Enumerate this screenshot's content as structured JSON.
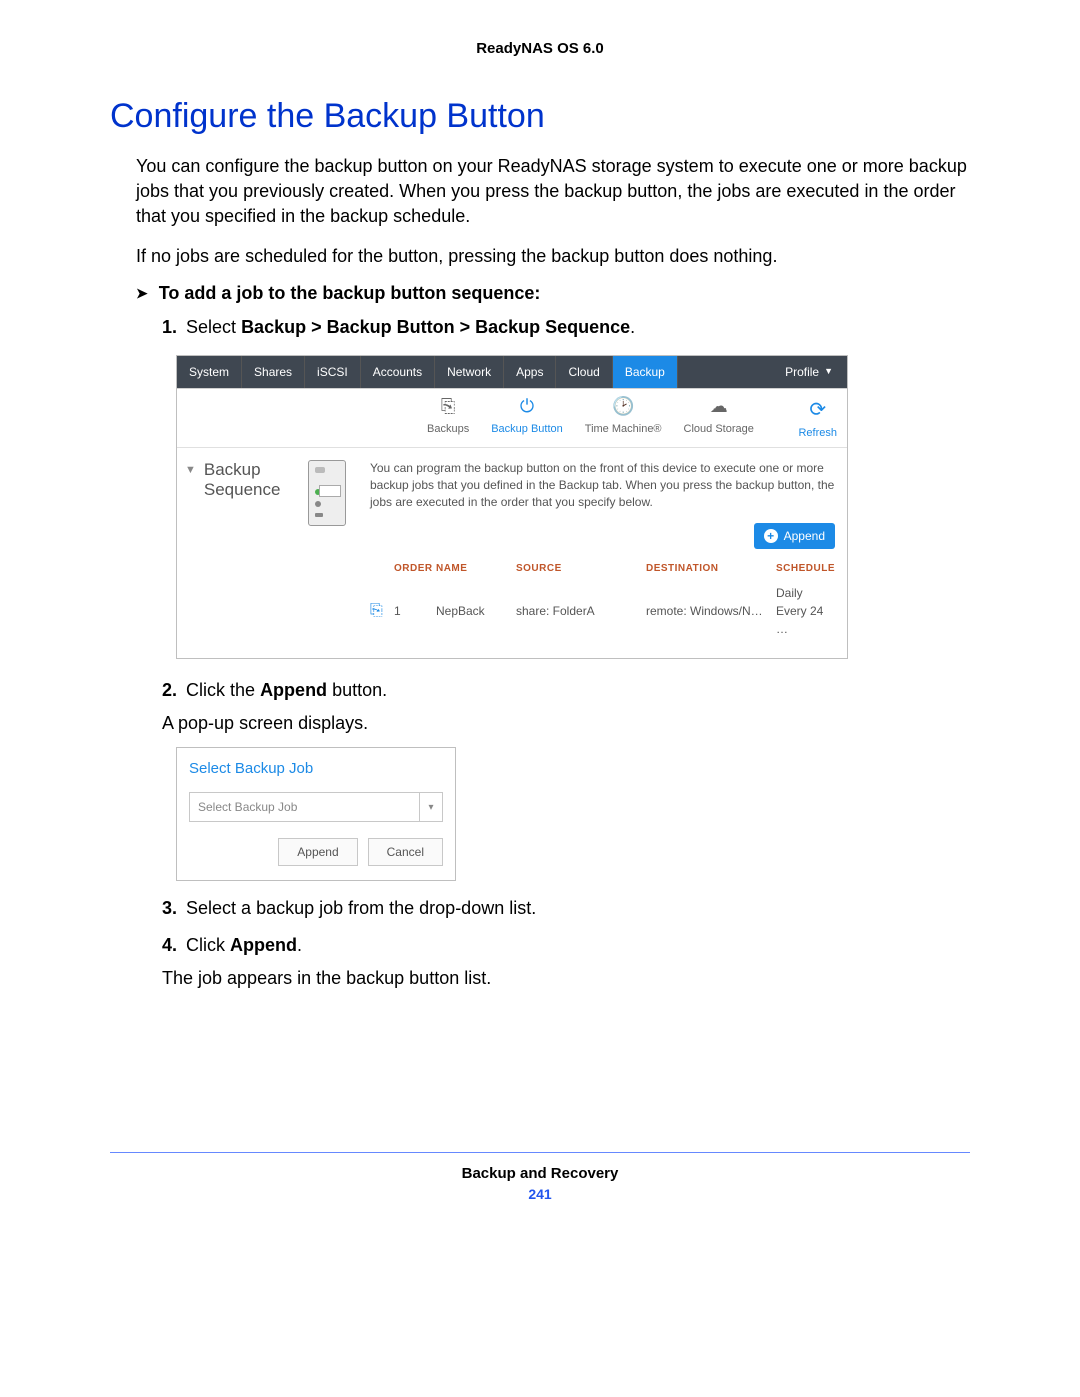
{
  "header": {
    "product": "ReadyNAS OS 6.0"
  },
  "title": "Configure the Backup Button",
  "intro1": "You can configure the backup button on your ReadyNAS storage system to execute one or more backup jobs that you previously created. When you press the backup button, the jobs are executed in the order that you specified in the backup schedule.",
  "intro2": "If no jobs are scheduled for the button, pressing the backup button does nothing.",
  "proc_heading": "To add a job to the backup button sequence:",
  "steps": {
    "s1a": "Select ",
    "s1b": "Backup > Backup Button > Backup Sequence",
    "s1c": ".",
    "s2a": "Click the ",
    "s2b": "Append",
    "s2c": " button.",
    "s2sub": "A pop-up screen displays.",
    "s3": "Select a backup job from the drop-down list.",
    "s4a": "Click ",
    "s4b": "Append",
    "s4c": ".",
    "s4sub": "The job appears in the backup button list."
  },
  "ui": {
    "tabs": {
      "system": "System",
      "shares": "Shares",
      "iscsi": "iSCSI",
      "accounts": "Accounts",
      "network": "Network",
      "apps": "Apps",
      "cloud": "Cloud",
      "backup": "Backup",
      "profile": "Profile"
    },
    "subtabs": {
      "backups": "Backups",
      "backup_button": "Backup Button",
      "time_machine": "Time Machine®",
      "cloud_storage": "Cloud Storage",
      "refresh": "Refresh"
    },
    "section_label_l1": "Backup",
    "section_label_l2": "Sequence",
    "desc": "You can program the backup button on the front of this device to execute one or more backup jobs that you defined in the Backup tab. When you press the backup button, the jobs are executed in the order that you specify below.",
    "append_btn": "Append",
    "cols": {
      "order": "ORDER",
      "name": "NAME",
      "source": "SOURCE",
      "destination": "DESTINATION",
      "schedule": "SCHEDULE"
    },
    "row": {
      "order": "1",
      "name": "NepBack",
      "source": "share: FolderA",
      "destination": "remote: Windows/N…",
      "schedule": "Daily Every 24 …"
    }
  },
  "dialog": {
    "title": "Select Backup Job",
    "placeholder": "Select Backup Job",
    "append": "Append",
    "cancel": "Cancel"
  },
  "footer": {
    "section": "Backup and Recovery",
    "page": "241"
  }
}
